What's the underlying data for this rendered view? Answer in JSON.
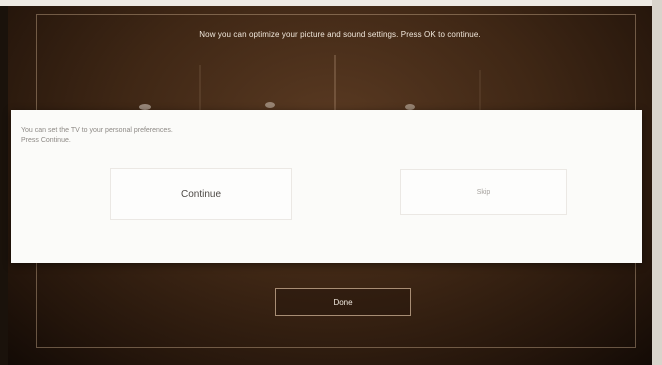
{
  "header": {
    "instruction": "Now you can optimize your picture and sound settings. Press OK to continue."
  },
  "dialog": {
    "message_line1": "You can set the TV to your personal preferences.",
    "message_line2": "Press Continue.",
    "continue_label": "Continue",
    "skip_label": "Skip"
  },
  "footer": {
    "done_label": "Done"
  },
  "colors": {
    "background": "#3f2715",
    "dialog_background": "#fbfbf9",
    "frame_line": "#c8aa8c"
  }
}
